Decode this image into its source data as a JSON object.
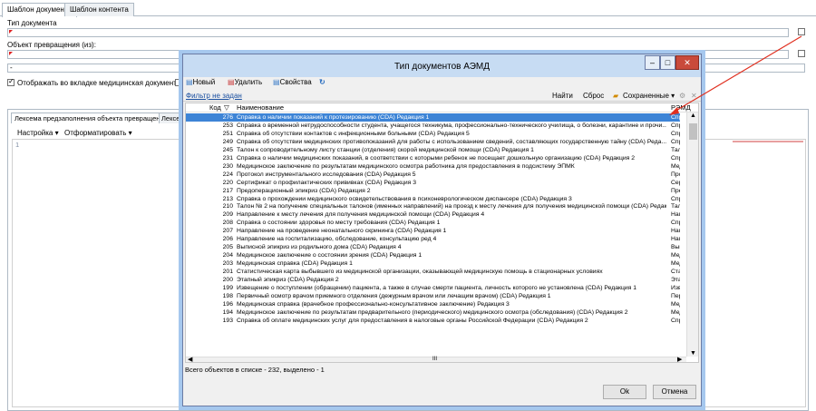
{
  "tabs": [
    "Шаблон документа",
    "Шаблон контента"
  ],
  "form": {
    "doc_type_label": "Тип документа",
    "transform_object_label": "Объект превращения (из):",
    "third_field_value": "-",
    "checkbox_label": "Отображать во вкладке медицинская документация",
    "lower_tab_1": "Лексема предзаполнения объекта превращения",
    "lower_tab_2": "Лексем",
    "settings_menu": "Настройка ▾",
    "format_menu": "Отформатировать ▾",
    "line_number": "1"
  },
  "dialog": {
    "title": "Тип документов АЭМД",
    "toolbar": {
      "new": "Новый",
      "delete": "Удалить",
      "properties": "Свойства",
      "refresh": "C"
    },
    "filter_link": "Фильтр не задан",
    "find": "Найти",
    "reset": "Сброс",
    "saved": "Сохраненные ▾",
    "columns": {
      "code": "Код",
      "name": "Наименование",
      "emd": "РЭМД"
    },
    "rows": [
      {
        "code": "276",
        "name": "Справка о наличии показаний к протезированию (CDA) Редакция 1",
        "emd": "Справ",
        "selected": true
      },
      {
        "code": "253",
        "name": "Справка о временной нетрудоспособности студента, учащегося техникума, профессионально-технического училища, о болезни, карантине и прочи...",
        "emd": "Справ"
      },
      {
        "code": "251",
        "name": "Справка об отсутствии контактов с инфекционными больными (CDA) Редакция 5",
        "emd": "Справ"
      },
      {
        "code": "249",
        "name": "Справка об отсутствии медицинских противопоказаний для работы с использованием сведений, составляющих государственную тайну (CDA) Реда...",
        "emd": "Справ"
      },
      {
        "code": "245",
        "name": "Талон к сопроводительному листу станции (отделения) скорой медицинской помощи (CDA) Редакция 1",
        "emd": "Талон"
      },
      {
        "code": "231",
        "name": "Справка о наличии медицинских показаний, в соответствии с которыми ребенок не посещает дошкольную организацию (CDA) Редакция 2",
        "emd": "Справ"
      },
      {
        "code": "230",
        "name": "Медицинское заключение по результатам медицинского осмотра работника для предоставления в подсистему ЭПМК",
        "emd": "Меди"
      },
      {
        "code": "224",
        "name": "Протокол инструментального исследования (CDA) Редакция 5",
        "emd": "Проток"
      },
      {
        "code": "220",
        "name": "Сертификат о профилактических прививках (CDA) Редакция 3",
        "emd": "Серти"
      },
      {
        "code": "217",
        "name": "Предоперационный эпикриз (CDA) Редакция 2",
        "emd": "Предо"
      },
      {
        "code": "213",
        "name": "Справка о прохождении медицинского освидетельствования в психоневрологическом диспансере (CDA) Редакция 3",
        "emd": "Справ"
      },
      {
        "code": "210",
        "name": "Талон № 2 на получение специальных талонов (именных направлений) на проезд к месту лечения для получения медицинской помощи (CDA) Редакц...",
        "emd": "Талон"
      },
      {
        "code": "209",
        "name": "Направление к месту лечения для получения медицинской помощи (CDA) Редакция 4",
        "emd": "Напра"
      },
      {
        "code": "208",
        "name": "Справка о состоянии здоровья по месту требования (CDA) Редакция 1",
        "emd": "Справ"
      },
      {
        "code": "207",
        "name": "Направление на проведение неонатального скрининга (CDA) Редакция 1",
        "emd": "Напра"
      },
      {
        "code": "206",
        "name": "Направление на госпитализацию, обследование, консультацию ред 4",
        "emd": "Напра"
      },
      {
        "code": "205",
        "name": "Выписной эпикриз из родильного дома (CDA) Редакция 4",
        "emd": "Выпи"
      },
      {
        "code": "204",
        "name": "Медицинское заключение о состоянии зрения (CDA) Редакция 1",
        "emd": "Меди"
      },
      {
        "code": "203",
        "name": "Медицинская справка (CDA) Редакция 1",
        "emd": "Меди"
      },
      {
        "code": "201",
        "name": "Статистическая карта выбывшего из медицинской организации, оказывающей медицинскую помощь в стационарных условиях",
        "emd": "Стати"
      },
      {
        "code": "200",
        "name": "Этапный эпикриз (CDA) Редакция 2",
        "emd": "Этапн"
      },
      {
        "code": "199",
        "name": "Извещение о поступлении (обращении) пациента, а также в случае смерти пациента, личность которого не установлена (CDA) Редакция 1",
        "emd": "Извещ"
      },
      {
        "code": "198",
        "name": "Первичный осмотр врачом приемного отделения (дежурным врачом или лечащим врачом) (CDA) Редакция 1",
        "emd": "Перви"
      },
      {
        "code": "196",
        "name": "Медицинская справка (врачебное профессионально-консультативное заключение) Редакция 3",
        "emd": "Меди"
      },
      {
        "code": "194",
        "name": "Медицинское заключение по результатам предварительного (периодического) медицинского осмотра (обследования) (CDA) Редакция 2",
        "emd": "Меди"
      },
      {
        "code": "193",
        "name": "Справка об оплате медицинских услуг для предоставления в налоговые органы Российской Федерации (CDA) Редакция 2",
        "emd": "Справ"
      }
    ],
    "scroll_center": "III",
    "status": "Всего объектов в списке - 232, выделено - 1",
    "ok": "Ok",
    "cancel": "Отмена"
  },
  "colors": {
    "selection": "#3d84d6",
    "annotation_arrow": "#e03020",
    "title_bar": "#c7dcf3"
  }
}
